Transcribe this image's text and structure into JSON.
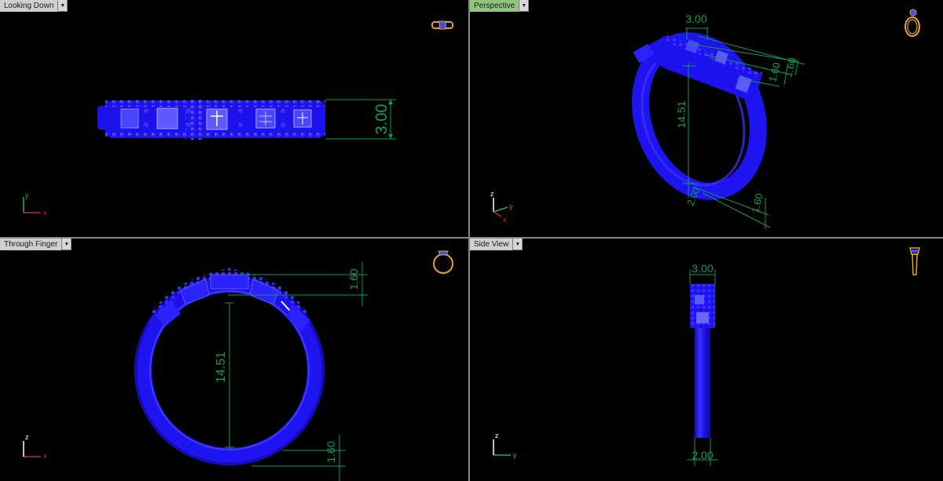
{
  "viewports": {
    "top_left": {
      "label": "Looking Down",
      "icon": "ring-top-icon"
    },
    "top_right": {
      "label": "Perspective",
      "icon": "ring-perspective-icon",
      "active": true
    },
    "bottom_left": {
      "label": "Through Finger",
      "icon": "ring-front-icon"
    },
    "bottom_right": {
      "label": "Side View",
      "icon": "ring-side-icon"
    }
  },
  "dimensions": {
    "top_left": {
      "width": "3.00"
    },
    "top_right": {
      "width": "3.00",
      "thickness_top_a": "1.60",
      "thickness_top_b": "1.60",
      "inner_diameter": "14.51",
      "bottom_width": "2.00",
      "bottom_thickness": "1.60"
    },
    "bottom_left": {
      "top_thickness": "1.60",
      "inner_diameter": "14.51",
      "bottom_thickness": "1.60"
    },
    "bottom_right": {
      "top_width": "3.00",
      "bottom_width": "2.00"
    }
  },
  "axes": {
    "top_left": [
      "y",
      "x"
    ],
    "top_right": [
      "z",
      "y",
      "x"
    ],
    "bottom_left": [
      "z",
      "x"
    ],
    "bottom_right": [
      "z",
      "y"
    ]
  },
  "colors": {
    "ring": "#1c12ee",
    "ring_highlight": "#4a44ff",
    "dimension": "#0d9c55",
    "icon": "#e8a21d",
    "axis_x": "#c0282c",
    "axis_y": "#2fae3a",
    "axis_z": "#ffffff",
    "active_tab": "#8fc57f"
  }
}
